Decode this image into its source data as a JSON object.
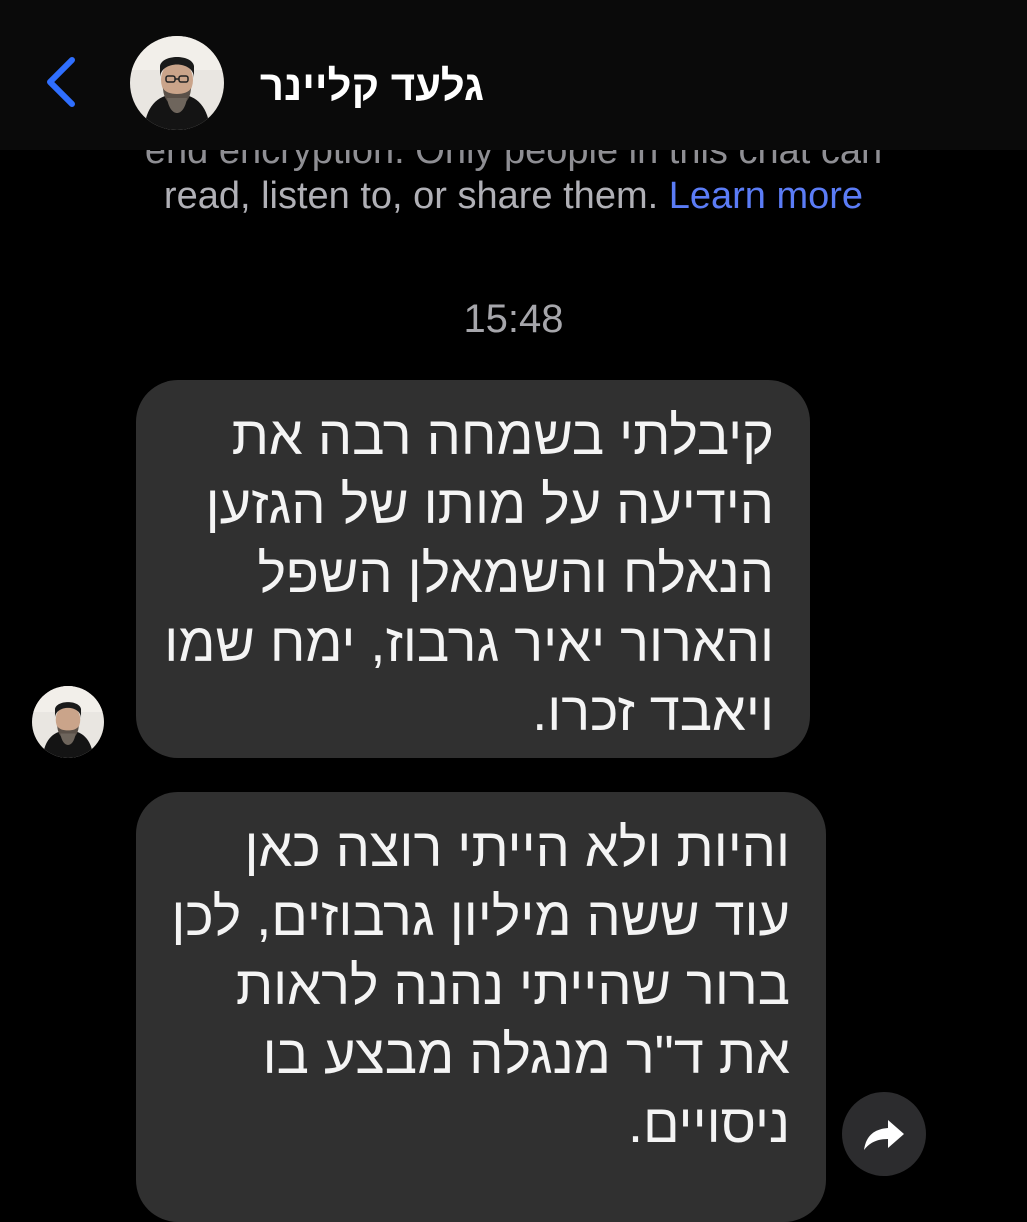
{
  "header": {
    "back_icon": "chevron-left-icon",
    "contact_name": "גלעד קליינר",
    "avatar_icon": "contact-avatar"
  },
  "notice": {
    "cut_line": "end encryption. Only people in this chat can",
    "line": "read, listen to, or share them.",
    "learn_more": "Learn more"
  },
  "timestamp": "15:48",
  "messages": [
    {
      "text": "קיבלתי בשמחה רבה את\nהידיעה על מותו של הגזען\nהנאלח והשמאלן השפל\nוהארור יאיר גרבוז, ימח שמו\nויאבד זכרו."
    },
    {
      "text": "והיות ולא הייתי רוצה כאן\nעוד ששה מיליון גרבוזים, לכן\nברור שהייתי נהנה לראות\nאת ד\"ר מנגלה מבצע בו\nניסויים."
    }
  ],
  "forward_icon": "forward-icon",
  "colors": {
    "background": "#000000",
    "header": "#0a0a0a",
    "bubble": "#303030",
    "accent": "#2f6fff",
    "link": "#5b7cf6",
    "muted_text": "#a6a6ab"
  }
}
